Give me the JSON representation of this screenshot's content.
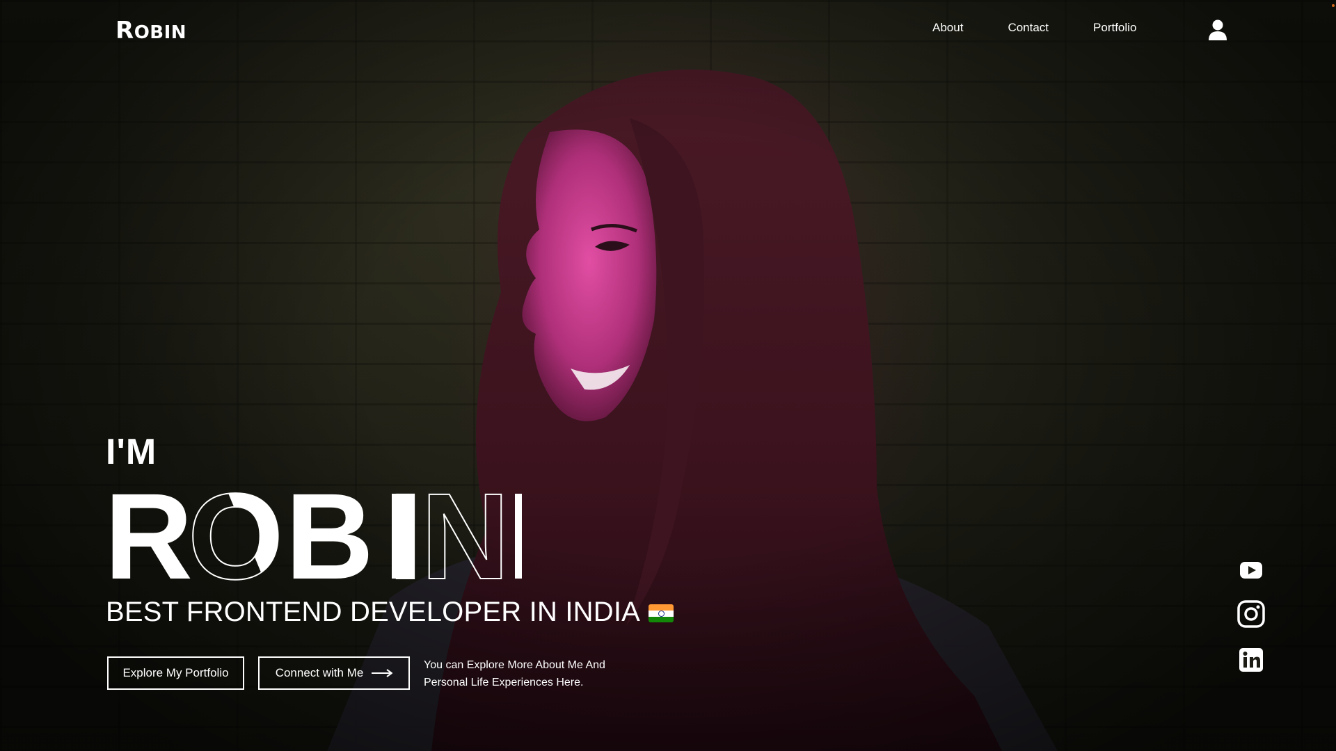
{
  "logo": {
    "initial": "R",
    "rest": "obin"
  },
  "nav": {
    "items": [
      "About",
      "Contact",
      "Portfolio"
    ]
  },
  "hero": {
    "intro": "I'M",
    "name": "ROBIN",
    "tagline": "BEST FRONTEND DEVELOPER IN INDIA",
    "flag_icon": "india-flag-icon",
    "buttons": {
      "explore": "Explore My Portfolio",
      "connect": "Connect with Me"
    },
    "blurb": "You can Explore More About Me And Personal Life Experiences Here."
  },
  "social": [
    "youtube-icon",
    "instagram-icon",
    "linkedin-icon"
  ],
  "colors": {
    "accent_pink": "#e0408f",
    "text": "#ffffff"
  }
}
